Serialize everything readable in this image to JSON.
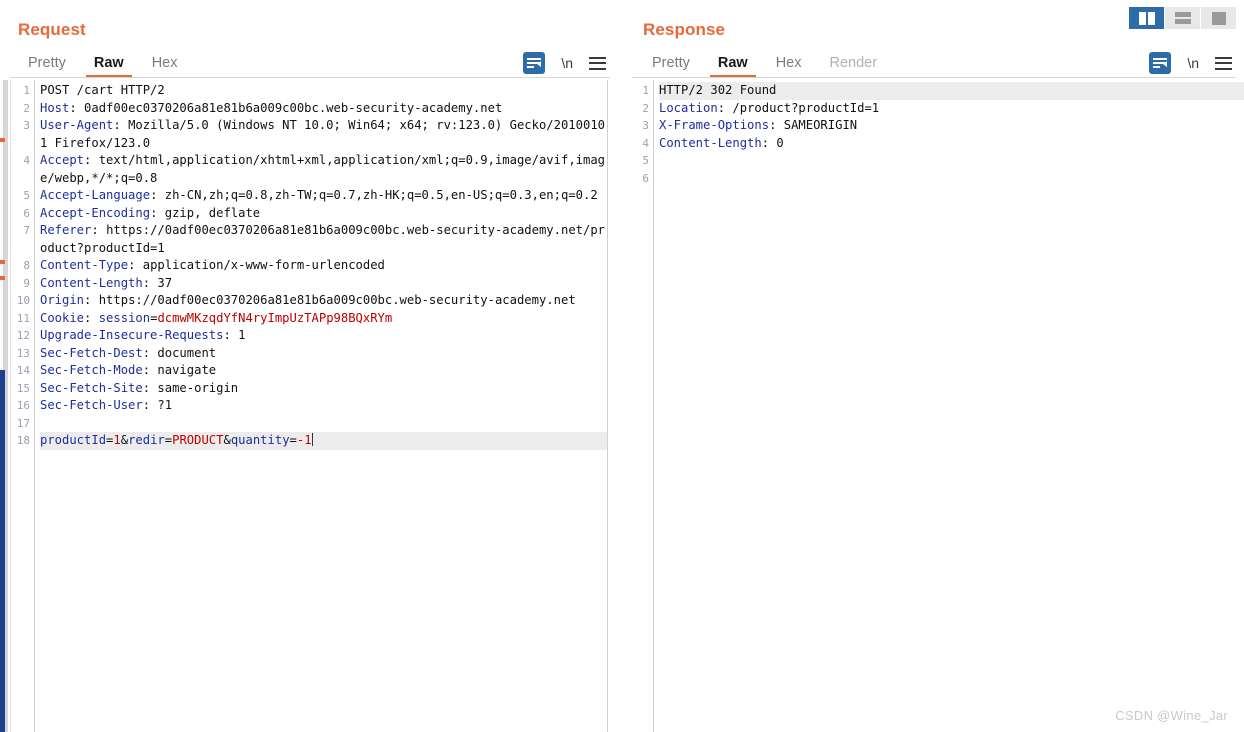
{
  "layout_toggles": [
    {
      "name": "split-view",
      "label": "",
      "active": true
    },
    {
      "name": "stacked-view",
      "label": "",
      "active": false
    },
    {
      "name": "single-view",
      "label": "",
      "active": false
    }
  ],
  "request": {
    "title": "Request",
    "tabs": [
      {
        "label": "Pretty",
        "active": false,
        "disabled": false
      },
      {
        "label": "Raw",
        "active": true,
        "disabled": false
      },
      {
        "label": "Hex",
        "active": false,
        "disabled": false
      }
    ],
    "tools": {
      "wrap_icon": "word-wrap-icon",
      "newline_label": "\\n",
      "menu_icon": "hamburger-menu-icon"
    },
    "lines": [
      {
        "num": 1,
        "type": "plain",
        "text": "POST /cart HTTP/2"
      },
      {
        "num": 2,
        "type": "header",
        "name": "Host",
        "value": "0adf00ec0370206a81e81b6a009c00bc.web-security-academy.net"
      },
      {
        "num": 3,
        "type": "header",
        "name": "User-Agent",
        "value": "Mozilla/5.0 (Windows NT 10.0; Win64; x64; rv:123.0) Gecko/20100101 Firefox/123.0"
      },
      {
        "num": 4,
        "type": "header",
        "name": "Accept",
        "value": "text/html,application/xhtml+xml,application/xml;q=0.9,image/avif,image/webp,*/*;q=0.8"
      },
      {
        "num": 5,
        "type": "header",
        "name": "Accept-Language",
        "value": "zh-CN,zh;q=0.8,zh-TW;q=0.7,zh-HK;q=0.5,en-US;q=0.3,en;q=0.2"
      },
      {
        "num": 6,
        "type": "header",
        "name": "Accept-Encoding",
        "value": "gzip, deflate"
      },
      {
        "num": 7,
        "type": "header",
        "name": "Referer",
        "value": "https://0adf00ec0370206a81e81b6a009c00bc.web-security-academy.net/product?productId=1"
      },
      {
        "num": 8,
        "type": "header",
        "name": "Content-Type",
        "value": "application/x-www-form-urlencoded"
      },
      {
        "num": 9,
        "type": "header",
        "name": "Content-Length",
        "value": "37"
      },
      {
        "num": 10,
        "type": "header",
        "name": "Origin",
        "value": "https://0adf00ec0370206a81e81b6a009c00bc.web-security-academy.net"
      },
      {
        "num": 11,
        "type": "cookie",
        "name": "Cookie",
        "cookie_name": "session",
        "cookie_value": "dcmwMKzqdYfN4ryImpUzTAPp98BQxRYm"
      },
      {
        "num": 12,
        "type": "header",
        "name": "Upgrade-Insecure-Requests",
        "value": "1"
      },
      {
        "num": 13,
        "type": "header",
        "name": "Sec-Fetch-Dest",
        "value": "document"
      },
      {
        "num": 14,
        "type": "header",
        "name": "Sec-Fetch-Mode",
        "value": "navigate"
      },
      {
        "num": 15,
        "type": "header",
        "name": "Sec-Fetch-Site",
        "value": "same-origin"
      },
      {
        "num": 16,
        "type": "header",
        "name": "Sec-Fetch-User",
        "value": "?1"
      },
      {
        "num": 17,
        "type": "empty",
        "text": ""
      },
      {
        "num": 18,
        "type": "body",
        "highlight": true,
        "params": [
          {
            "name": "productId",
            "value": "1",
            "sep": ""
          },
          {
            "name": "redir",
            "value": "PRODUCT",
            "sep": "&"
          },
          {
            "name": "quantity",
            "value": "-1",
            "sep": "&"
          }
        ]
      }
    ]
  },
  "response": {
    "title": "Response",
    "tabs": [
      {
        "label": "Pretty",
        "active": false,
        "disabled": false
      },
      {
        "label": "Raw",
        "active": true,
        "disabled": false
      },
      {
        "label": "Hex",
        "active": false,
        "disabled": false
      },
      {
        "label": "Render",
        "active": false,
        "disabled": true
      }
    ],
    "tools": {
      "wrap_icon": "word-wrap-icon",
      "newline_label": "\\n",
      "menu_icon": "hamburger-menu-icon"
    },
    "lines": [
      {
        "num": 1,
        "type": "plain",
        "highlight": true,
        "text": "HTTP/2 302 Found"
      },
      {
        "num": 2,
        "type": "header",
        "name": "Location",
        "value": "/product?productId=1"
      },
      {
        "num": 3,
        "type": "header",
        "name": "X-Frame-Options",
        "value": "SAMEORIGIN"
      },
      {
        "num": 4,
        "type": "header",
        "name": "Content-Length",
        "value": "0"
      },
      {
        "num": 5,
        "type": "empty",
        "text": ""
      },
      {
        "num": 6,
        "type": "empty",
        "text": ""
      }
    ]
  },
  "watermark": "CSDN @Wine_Jar",
  "colors": {
    "accent_orange": "#e8683a",
    "header_blue": "#1c2fa0",
    "value_red": "#c00000",
    "active_toggle": "#2d6ca6",
    "scroll_thumb": "#1f3f8f"
  }
}
